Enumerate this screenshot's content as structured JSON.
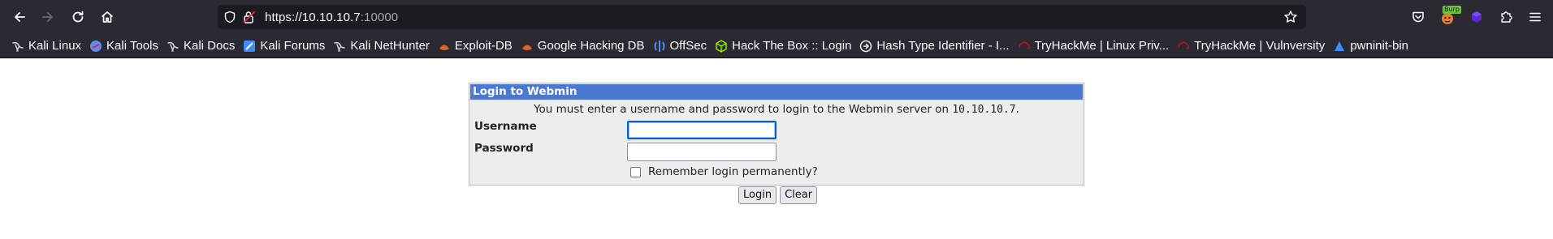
{
  "browser": {
    "url_host": "https://10.10.10.7",
    "url_port": ":10000",
    "bookmarks": [
      {
        "label": "Kali Linux",
        "icon": "kali-dragon-icon",
        "color": "#cfd4de"
      },
      {
        "label": "Kali Tools",
        "icon": "kali-tools-icon",
        "color": "#5b8ef0"
      },
      {
        "label": "Kali Docs",
        "icon": "kali-dragon-icon",
        "color": "#cfd4de"
      },
      {
        "label": "Kali Forums",
        "icon": "kali-forums-icon",
        "color": "#3d8bfd"
      },
      {
        "label": "Kali NetHunter",
        "icon": "kali-dragon-icon",
        "color": "#cfd4de"
      },
      {
        "label": "Exploit-DB",
        "icon": "exploit-db-icon",
        "color": "#e0622b"
      },
      {
        "label": "Google Hacking DB",
        "icon": "ghdb-icon",
        "color": "#e0622b"
      },
      {
        "label": "OffSec",
        "icon": "offsec-icon",
        "color": "#4f8ef7"
      },
      {
        "label": "Hack The Box :: Login",
        "icon": "htb-cube-icon",
        "color": "#9fef00"
      },
      {
        "label": "Hash Type Identifier - I...",
        "icon": "hash-identifier-icon",
        "color": "#e6e6e6"
      },
      {
        "label": "TryHackMe | Linux Priv...",
        "icon": "tryhackme-icon",
        "color": "#c11111"
      },
      {
        "label": "TryHackMe | Vulnversity",
        "icon": "tryhackme-icon",
        "color": "#c11111"
      },
      {
        "label": "pwninit-bin",
        "icon": "pwninit-icon",
        "color": "#3d8bfd"
      }
    ],
    "burp_badge": "Burp"
  },
  "login": {
    "title": "Login to Webmin",
    "message": "You must enter a username and password to login to the Webmin server on",
    "host": "10.10.10.7",
    "host_suffix": ".",
    "username_label": "Username",
    "password_label": "Password",
    "username_value": "",
    "password_value": "",
    "remember_label": "Remember login permanently?",
    "remember_checked": false,
    "login_button": "Login",
    "clear_button": "Clear"
  },
  "colors": {
    "chrome_bg": "#2b2a33",
    "urlbar_bg": "#1c1b22",
    "header_blue": "#4a78d3",
    "panel_bg": "#ededed"
  }
}
